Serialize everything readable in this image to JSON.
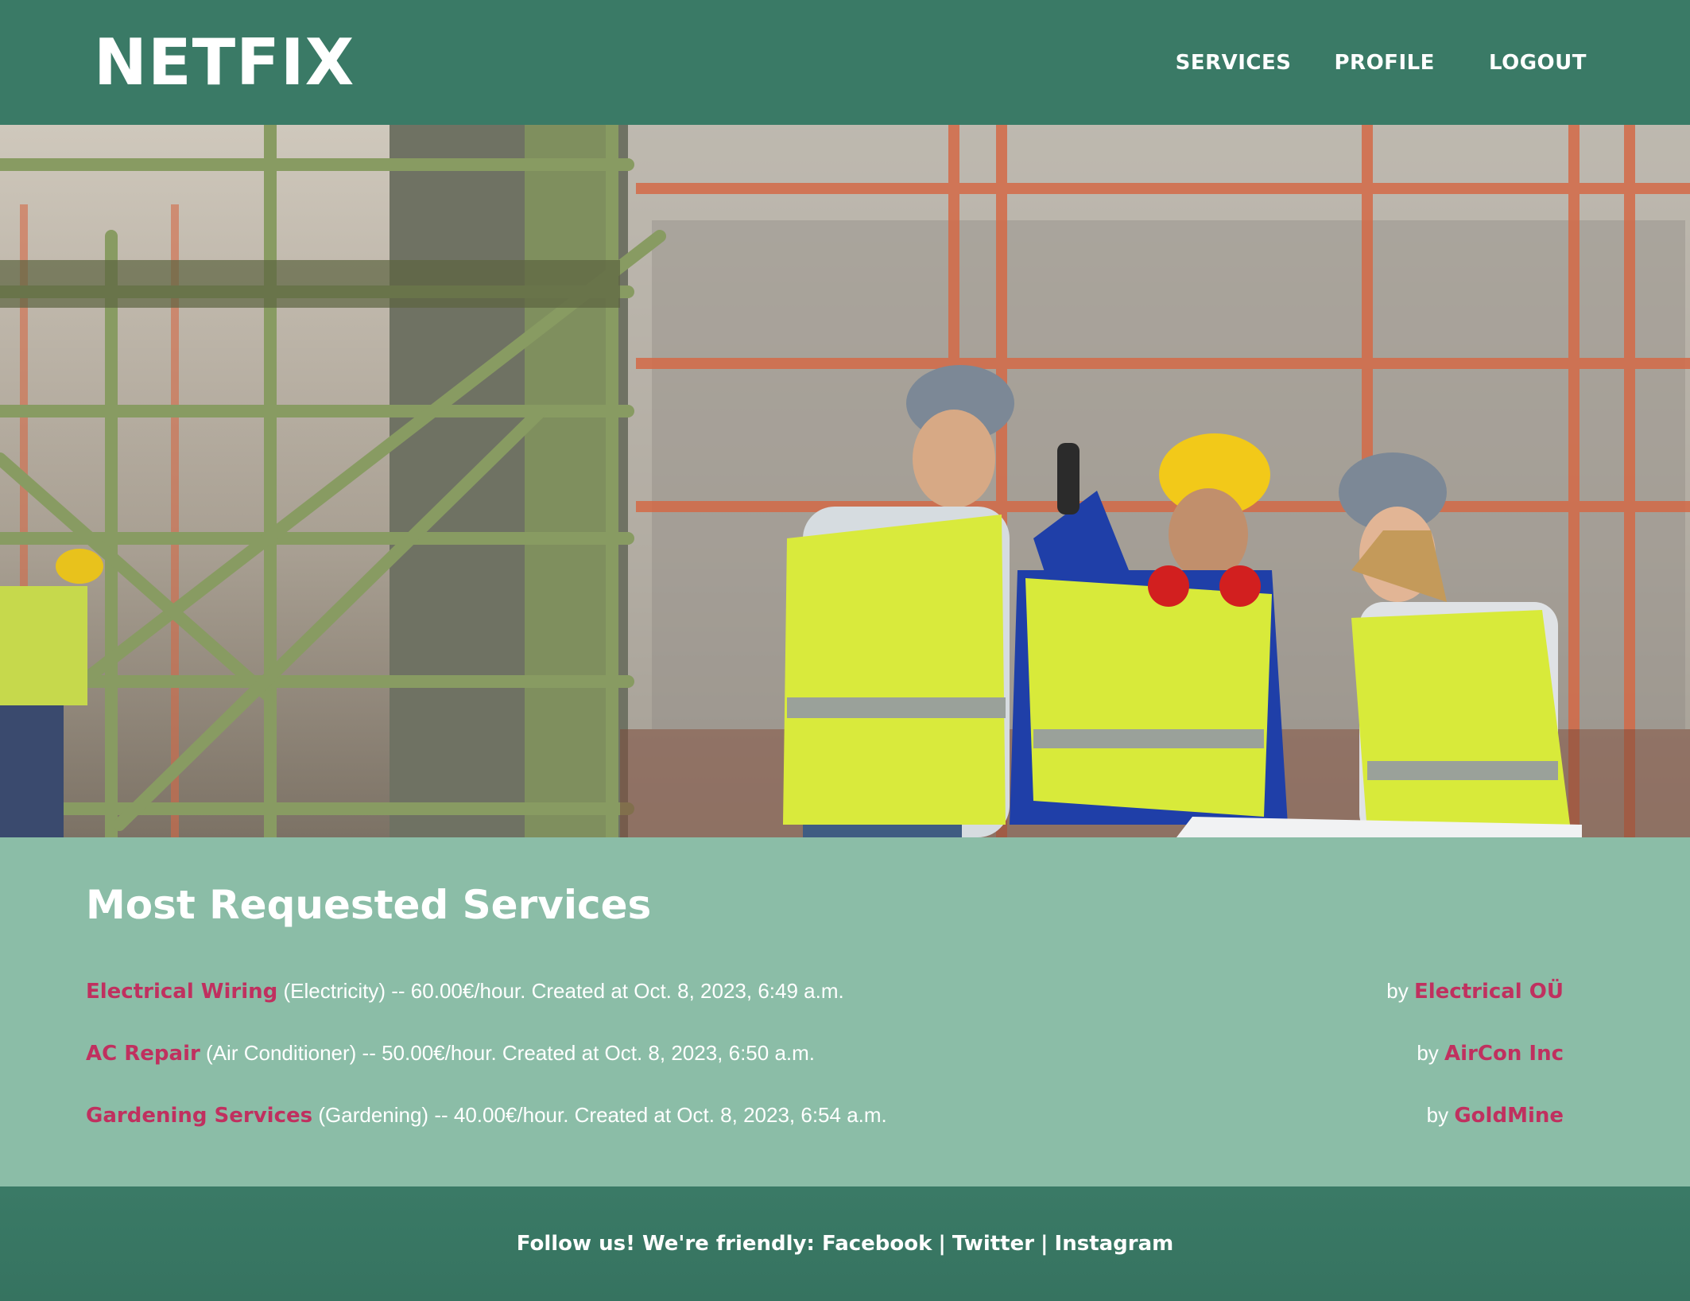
{
  "navbar": {
    "logo": "NETFIX",
    "links": [
      {
        "label": "SERVICES"
      },
      {
        "label": "PROFILE"
      },
      {
        "label": "LOGOUT"
      }
    ]
  },
  "hero": {
    "icon": "construction-workers-photo"
  },
  "services": {
    "title": "Most Requested Services",
    "items": [
      {
        "name": "Electrical Wiring",
        "meta": "(Electricity) -- 60.00€/hour. Created at Oct. 8, 2023, 6:49 a.m.",
        "by": "by",
        "provider": "Electrical OÜ"
      },
      {
        "name": "AC Repair",
        "meta": "(Air Conditioner) -- 50.00€/hour. Created at Oct. 8, 2023, 6:50 a.m.",
        "by": "by",
        "provider": "AirCon Inc"
      },
      {
        "name": "Gardening Services",
        "meta": "(Gardening) -- 40.00€/hour. Created at Oct. 8, 2023, 6:54 a.m.",
        "by": "by",
        "provider": "GoldMine"
      }
    ]
  },
  "footer": {
    "lead": "Follow us! We're friendly:",
    "links": [
      {
        "label": "Facebook"
      },
      {
        "label": "Twitter"
      },
      {
        "label": "Instagram"
      }
    ],
    "separator": "|"
  },
  "colors": {
    "navbar_bg": "#3a7a66",
    "content_bg": "#8bbda7",
    "link_accent": "#c0305f"
  }
}
